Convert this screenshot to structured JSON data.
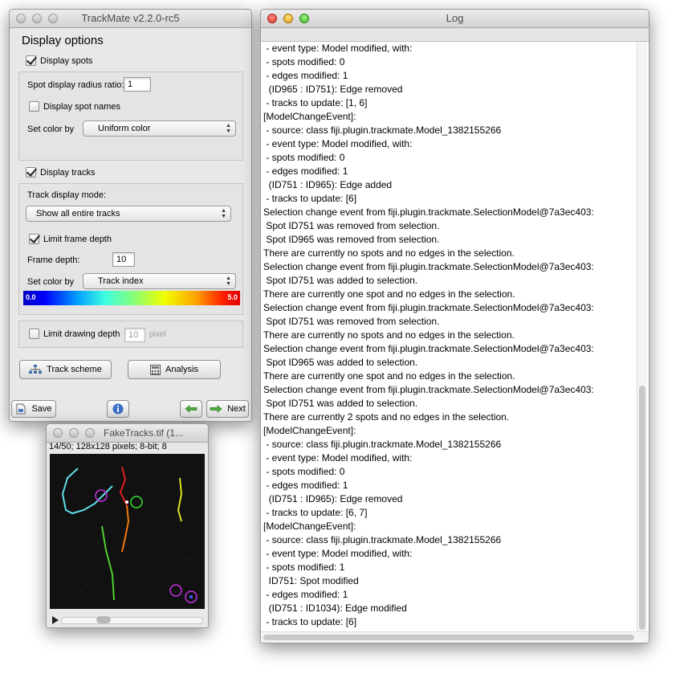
{
  "trackmate": {
    "window_title": "TrackMate v2.2.0-rc5",
    "panel_title": "Display options",
    "display_spots_label": "Display spots",
    "spot_radius_label": "Spot display radius ratio:",
    "spot_radius_value": "1",
    "spot_names_label": "Display spot names",
    "spot_color_label": "Set color by",
    "spot_color_value": "Uniform color",
    "display_tracks_label": "Display tracks",
    "track_mode_label": "Track display mode:",
    "track_mode_value": "Show all entire tracks",
    "limit_frame_label": "Limit frame depth",
    "frame_depth_label": "Frame depth:",
    "frame_depth_value": "10",
    "track_color_label": "Set color by",
    "track_color_value": "Track index",
    "colormap_min": "0.0",
    "colormap_max": "5.0",
    "limit_draw_label": "Limit drawing depth",
    "draw_depth_value": "10",
    "draw_depth_unit": "pixel",
    "track_scheme_label": "Track scheme",
    "analysis_label": "Analysis",
    "save_label": "Save",
    "next_label": "Next"
  },
  "faketracks": {
    "window_title": "FakeTracks.tif (1...",
    "info": "14/50; 128x128 pixels; 8-bit; 8"
  },
  "log": {
    "window_title": "Log",
    "lines": [
      " - event type: Model modified, with:",
      " - spots modified: 0",
      " - edges modified: 1",
      "  (ID965 : ID751): Edge removed",
      " - tracks to update: [1, 6]",
      "[ModelChangeEvent]:",
      " - source: class fiji.plugin.trackmate.Model_1382155266",
      " - event type: Model modified, with:",
      " - spots modified: 0",
      " - edges modified: 1",
      "  (ID751 : ID965): Edge added",
      " - tracks to update: [6]",
      "Selection change event from fiji.plugin.trackmate.SelectionModel@7a3ec403:",
      " Spot ID751 was removed from selection.",
      " Spot ID965 was removed from selection.",
      "There are currently no spots and no edges in the selection.",
      "Selection change event from fiji.plugin.trackmate.SelectionModel@7a3ec403:",
      " Spot ID751 was added to selection.",
      "There are currently one spot and no edges in the selection.",
      "Selection change event from fiji.plugin.trackmate.SelectionModel@7a3ec403:",
      " Spot ID751 was removed from selection.",
      "There are currently no spots and no edges in the selection.",
      "Selection change event from fiji.plugin.trackmate.SelectionModel@7a3ec403:",
      " Spot ID965 was added to selection.",
      "There are currently one spot and no edges in the selection.",
      "Selection change event from fiji.plugin.trackmate.SelectionModel@7a3ec403:",
      " Spot ID751 was added to selection.",
      "There are currently 2 spots and no edges in the selection.",
      "[ModelChangeEvent]:",
      " - source: class fiji.plugin.trackmate.Model_1382155266",
      " - event type: Model modified, with:",
      " - spots modified: 0",
      " - edges modified: 1",
      "  (ID751 : ID965): Edge removed",
      " - tracks to update: [6, 7]",
      "[ModelChangeEvent]:",
      " - source: class fiji.plugin.trackmate.Model_1382155266",
      " - event type: Model modified, with:",
      " - spots modified: 1",
      "  ID751: Spot modified",
      " - edges modified: 1",
      "  (ID751 : ID1034): Edge modified",
      " - tracks to update: [6]"
    ]
  }
}
